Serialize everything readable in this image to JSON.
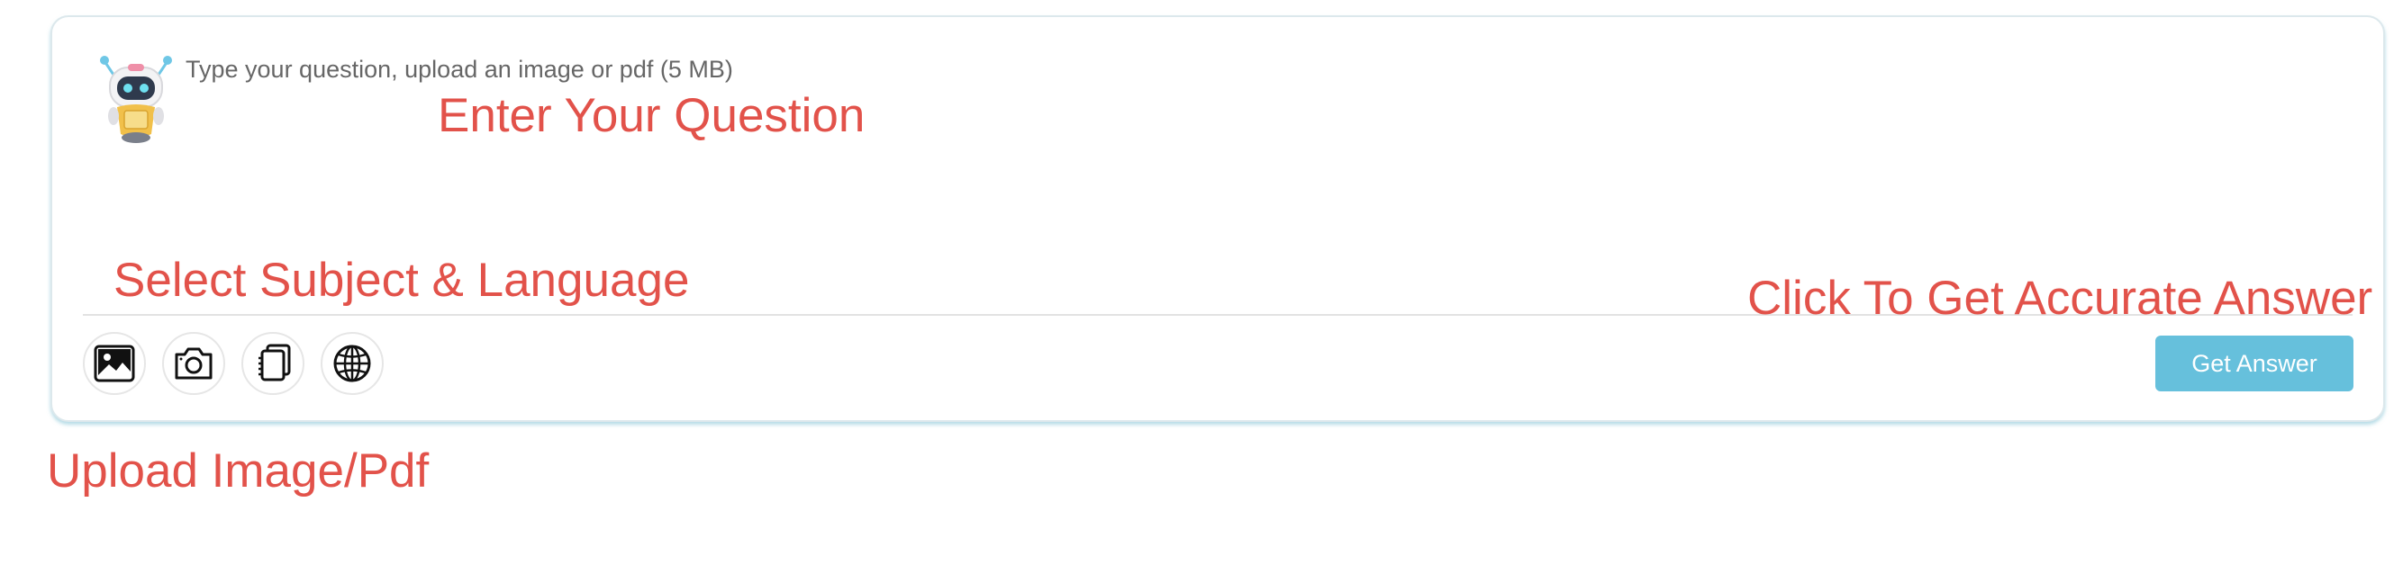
{
  "composer": {
    "avatar_name": "robot-assistant",
    "question_placeholder": "Type your question, upload an image or pdf (5 MB)",
    "question_value": "",
    "toolbar": [
      {
        "icon": "image-icon",
        "label": "Upload image"
      },
      {
        "icon": "camera-icon",
        "label": "Take photo"
      },
      {
        "icon": "documents-icon",
        "label": "Select subject"
      },
      {
        "icon": "globe-icon",
        "label": "Select language"
      }
    ],
    "submit_label": "Get Answer"
  },
  "annotations": {
    "enter_question": "Enter Your Question",
    "select_subject_language": "Select Subject & Language",
    "get_answer": "Click To Get Accurate Answer",
    "upload": "Upload Image/Pdf"
  },
  "colors": {
    "annotation_text": "#e2524a",
    "button_background": "#66c0dc",
    "card_border": "#dce8ec",
    "card_shadow": "#78bed2"
  }
}
